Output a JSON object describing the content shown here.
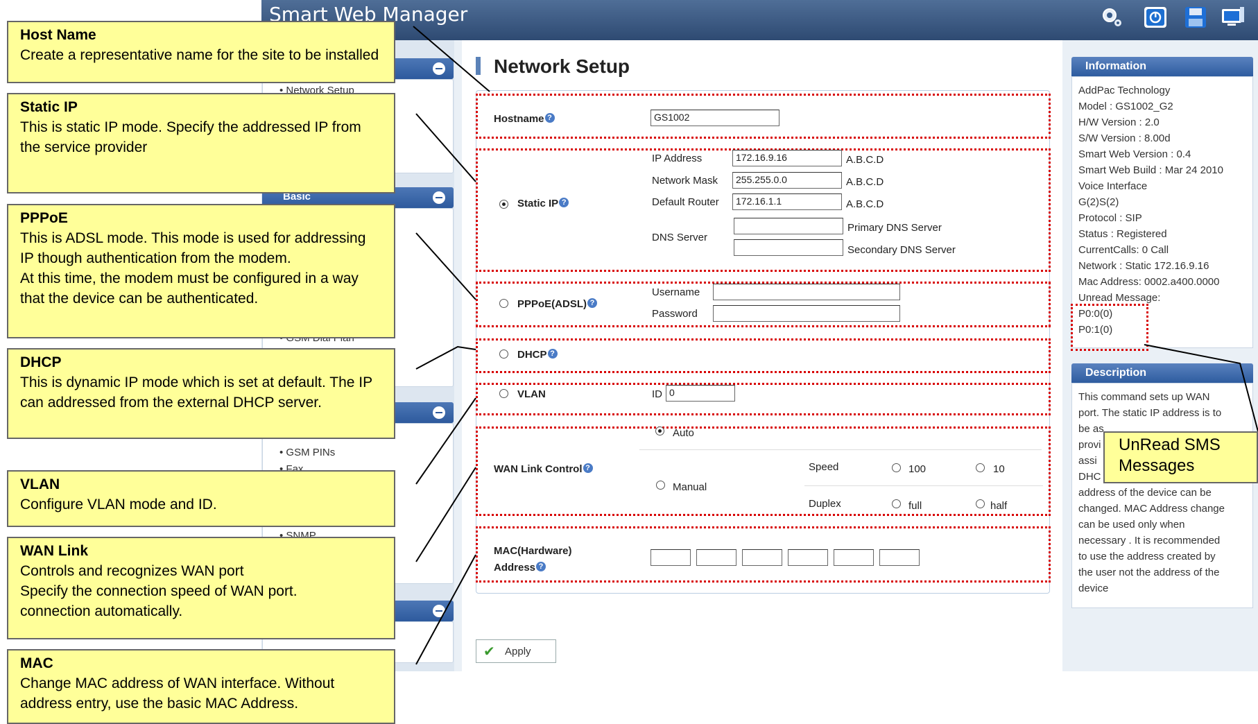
{
  "app": {
    "title": "Smart Web Manager"
  },
  "toolbar_icons": [
    "settings-icon",
    "power-icon",
    "save-icon",
    "monitor-icon"
  ],
  "sidebar": {
    "items": [
      "Network Setup",
      "GSM Dial Plan",
      "GSM PINs",
      "Fax",
      "SNMP"
    ],
    "basic_label": "Basic"
  },
  "page": {
    "title": "Network Setup"
  },
  "form": {
    "hostname": {
      "label": "Hostname",
      "value": "GS1002"
    },
    "static_ip": {
      "label": "Static IP",
      "ip_label": "IP Address",
      "ip_value": "172.16.9.16",
      "mask_label": "Network Mask",
      "mask_value": "255.255.0.0",
      "router_label": "Default Router",
      "router_value": "172.16.1.1",
      "abcd": "A.B.C.D",
      "dns_label": "DNS Server",
      "primary_dns": "Primary DNS Server",
      "secondary_dns": "Secondary DNS Server"
    },
    "pppoe": {
      "label": "PPPoE(ADSL)",
      "username_label": "Username",
      "password_label": "Password"
    },
    "dhcp": {
      "label": "DHCP"
    },
    "vlan": {
      "label": "VLAN",
      "id_label": "ID",
      "id_value": "0"
    },
    "wan": {
      "label": "WAN Link Control",
      "auto": "Auto",
      "manual": "Manual",
      "speed_label": "Speed",
      "speed_100": "100",
      "speed_10": "10",
      "duplex_label": "Duplex",
      "duplex_full": "full",
      "duplex_half": "half"
    },
    "mac": {
      "label_1": "MAC(Hardware)",
      "label_2": "Address"
    },
    "apply": "Apply"
  },
  "information": {
    "title": "Information",
    "lines": [
      "AddPac Technology",
      "Model : GS1002_G2",
      "H/W Version : 2.0",
      "S/W Version : 8.00d",
      "Smart Web Version : 0.4",
      "Smart Web Build : Mar 24 2010",
      "Voice Interface",
      "   G(2)S(2)",
      "Protocol : SIP",
      "Status : Registered",
      "CurrentCalls: 0 Call",
      "Network : Static 172.16.9.16",
      "Mac Address: 0002.a400.0000",
      "Unread Message:",
      "P0:0(0)",
      "P0:1(0)"
    ]
  },
  "description": {
    "title": "Description",
    "lines": [
      "This command sets up WAN",
      "port. The static IP address is to",
      "be as",
      "provi",
      "assi",
      "DHC",
      "address of the device can be",
      "changed. MAC Address change",
      "can be used only when",
      "necessary . It is recommended",
      "to use the address created by",
      "the user not the address of the",
      "device"
    ]
  },
  "callouts": [
    {
      "title": "Host Name",
      "text": "Create a representative name for the site to be installed"
    },
    {
      "title": "Static IP",
      "text": "This is static IP mode. Specify the addressed IP from the service provider"
    },
    {
      "title": "PPPoE",
      "text": "This is ADSL mode. This mode is used for addressing IP though authentication from the modem.\nAt this time, the modem must be configured in a way that the device can be authenticated."
    },
    {
      "title": "DHCP",
      "text": "This is dynamic IP mode which is set at default. The IP can addressed from the external DHCP server."
    },
    {
      "title": "VLAN",
      "text": "Configure VLAN mode and ID."
    },
    {
      "title": "WAN Link",
      "text": "Controls and recognizes WAN port\nSpecify the connection speed of WAN port.\nconnection automatically."
    },
    {
      "title": "MAC",
      "text": "Change MAC address of WAN interface. Without address entry, use the basic MAC Address."
    }
  ],
  "sms_callout": "UnRead SMS Messages"
}
